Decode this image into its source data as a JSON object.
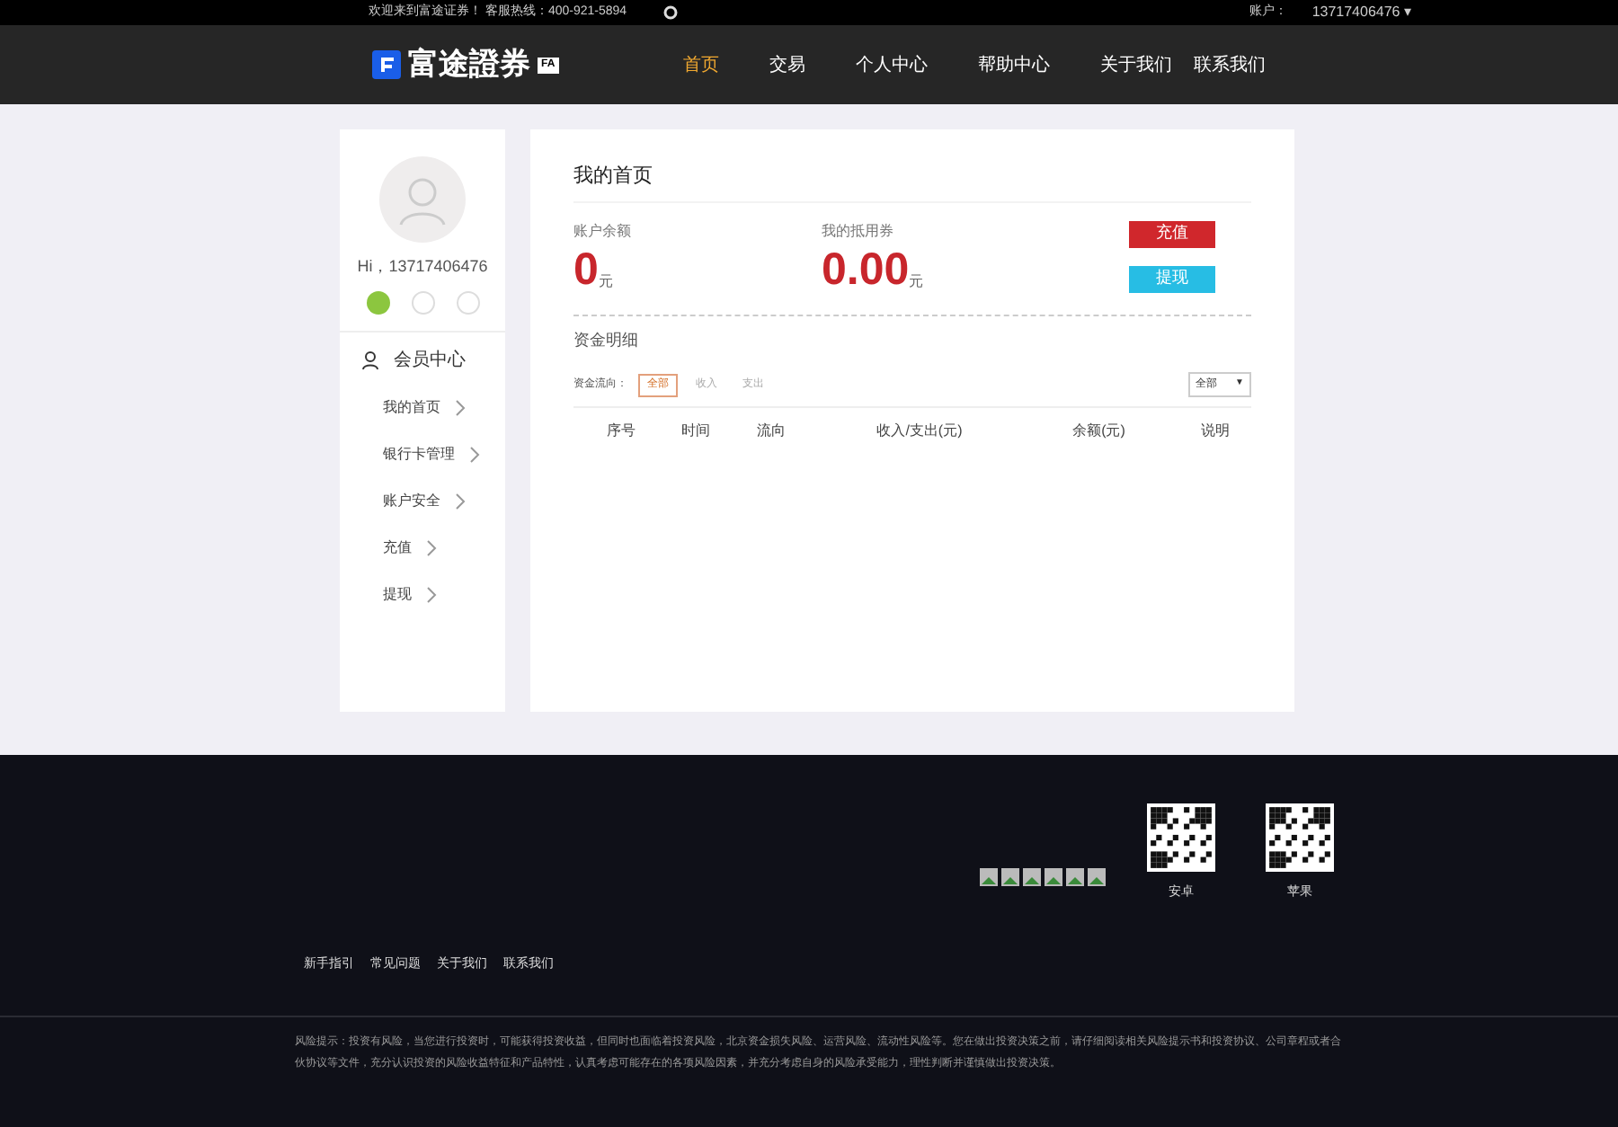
{
  "top_bar": {
    "welcome": "欢迎来到富途证券！ 客服热线：400-921-5894",
    "account_label": "账户：",
    "account": "13717406476",
    "caret": "▾"
  },
  "header": {
    "logo": "富途證券",
    "logo_badge": "FA",
    "nav": [
      {
        "label": "首页",
        "selected": true
      },
      {
        "label": "交易",
        "selected": false
      },
      {
        "label": "个人中心",
        "selected": false
      },
      {
        "label": "帮助中心",
        "selected": false
      },
      {
        "label": "关于我们",
        "selected": false
      },
      {
        "label": "联系我们",
        "selected": false
      }
    ]
  },
  "sidebar": {
    "greeting": "Hi，13717406476",
    "badges": [
      {
        "on": true
      },
      {
        "on": false
      },
      {
        "on": false
      }
    ],
    "section": "会员中心",
    "items": [
      "我的首页",
      "银行卡管理",
      "账户安全",
      "充值",
      "提现"
    ]
  },
  "main": {
    "title": "我的首页",
    "balances": [
      {
        "label": "账户余额",
        "amount": "0",
        "unit": "元"
      },
      {
        "label": "我的抵用券",
        "amount": "0.00",
        "unit": "元"
      }
    ],
    "buttons": [
      {
        "label": "充值",
        "kind": "recharge"
      },
      {
        "label": "提现",
        "kind": "withdraw"
      }
    ],
    "details_title": "资金明细",
    "filter_label": "资金流向：",
    "filters": [
      {
        "label": "全部",
        "selected": true
      },
      {
        "label": "收入",
        "selected": false
      },
      {
        "label": "支出",
        "selected": false
      }
    ],
    "select": {
      "value": "全部",
      "caret": "▼"
    },
    "columns": [
      "序号",
      "时间",
      "流向",
      "收入/支出(元)",
      "余额(元)",
      "说明"
    ]
  },
  "footer": {
    "qr_codes": [
      "安卓",
      "苹果"
    ],
    "links": [
      "新手指引",
      "常见问题",
      "关于我们",
      "联系我们"
    ],
    "risk": "风险提示：投资有风险，当您进行投资时，可能获得投资收益，但同时也面临着投资风险，北京资金损失风险、运营风险、流动性风险等。您在做出投资决策之前，请仔细阅读相关风险提示书和投资协议、公司章程或者合伙协议等文件，充分认识投资的风险收益特征和产品特性，认真考虑可能存在的各项风险因素，并充分考虑自身的风险承受能力，理性判断并谨慎做出投资决策。"
  }
}
